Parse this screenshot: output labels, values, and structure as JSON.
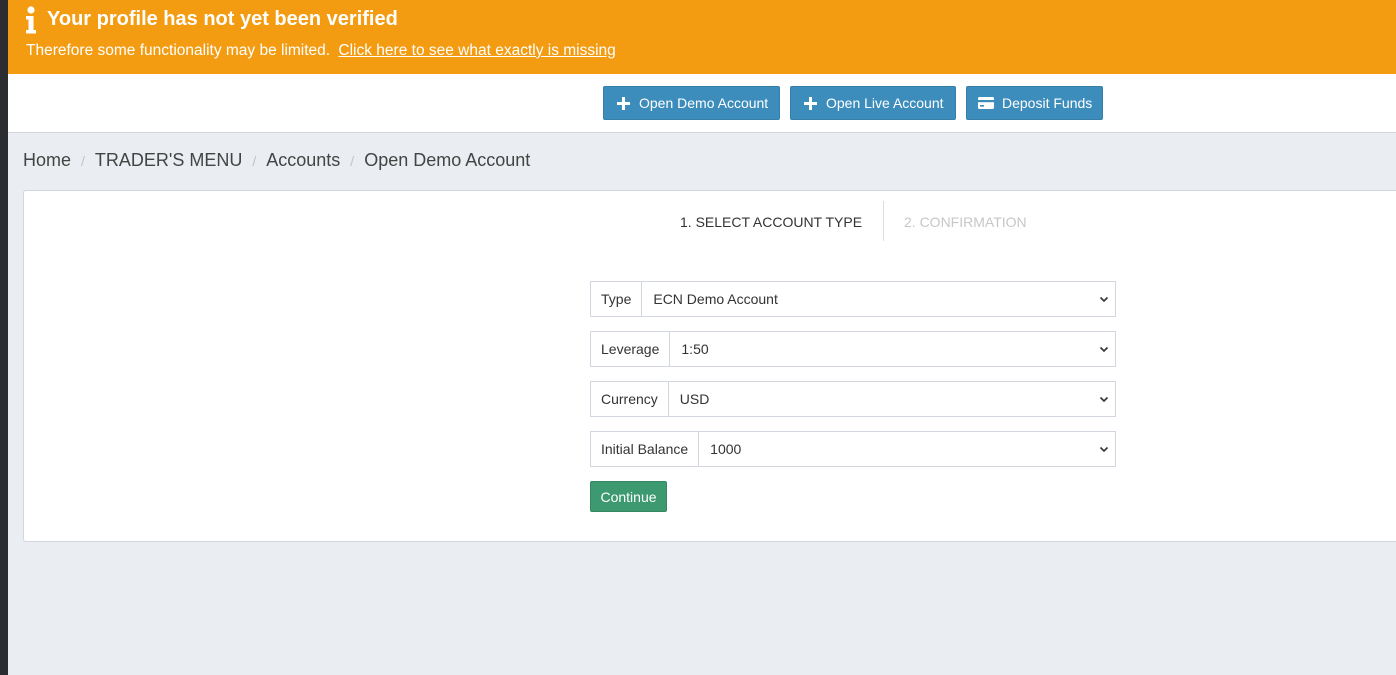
{
  "alert": {
    "icon": "info-icon",
    "title": "Your profile has not yet been verified",
    "text": "Therefore some functionality may be limited.",
    "link": "Click here to see what exactly is missing",
    "background_color": "#f39c12"
  },
  "toolbar": {
    "open_demo_label": "Open Demo Account",
    "open_live_label": "Open Live Account",
    "deposit_label": "Deposit Funds",
    "button_color": "#3c8dbc"
  },
  "breadcrumb": {
    "items": [
      "Home",
      "TRADER'S MENU",
      "Accounts",
      "Open Demo Account"
    ],
    "separator": "/"
  },
  "wizard": {
    "steps": [
      "1. SELECT ACCOUNT TYPE",
      "2. CONFIRMATION"
    ],
    "active_step": 1
  },
  "form": {
    "type": {
      "label": "Type",
      "value": "ECN Demo Account"
    },
    "leverage": {
      "label": "Leverage",
      "value": "1:50"
    },
    "currency": {
      "label": "Currency",
      "value": "USD"
    },
    "initial_balance": {
      "label": "Initial Balance",
      "value": "1000"
    },
    "continue_label": "Continue",
    "continue_color": "#3d9970"
  }
}
